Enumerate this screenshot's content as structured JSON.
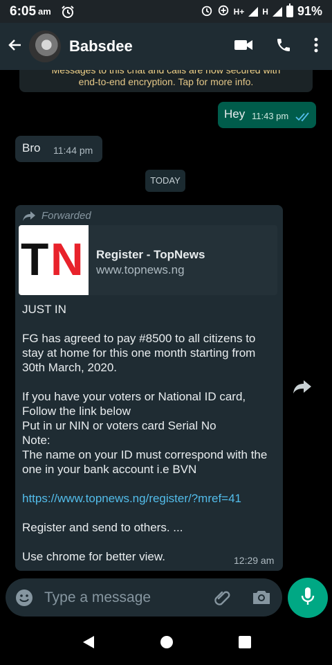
{
  "status": {
    "time": "6:05",
    "ampm": "am",
    "network_hplus": "H+",
    "network_h": "H",
    "battery_percent": "91%"
  },
  "header": {
    "contact_name": "Babsdee"
  },
  "chat": {
    "encryption_notice": {
      "line1": "Messages to this chat and calls are now secured with",
      "line2": "end-to-end encryption. Tap for more info."
    },
    "outgoing": {
      "text": "Hey",
      "time": "11:43 pm",
      "status": "read"
    },
    "incoming": {
      "text": "Bro",
      "time": "11:44 pm"
    },
    "date_divider": "TODAY",
    "forwarded": {
      "label": "Forwarded",
      "preview": {
        "thumb_text_t": "T",
        "thumb_text_n": "N",
        "title": "Register - TopNews",
        "domain": "www.topnews.ng"
      },
      "lines": {
        "l1": "JUST IN",
        "l2": "FG has agreed to pay #8500 to all citizens to stay at home for this one month starting from 30th March, 2020.",
        "l3": "If you have your voters or National ID card, Follow the link below",
        "l4": "Put in ur NIN or voters card Serial No",
        "l5": "Note:",
        "l6": "The name on your ID must correspond with the one in your bank account i.e BVN",
        "link": "https://www.topnews.ng/register/?mref=41",
        "l7": "Register and send to others. ...",
        "l8": "Use chrome for better view."
      },
      "time": "12:29 am"
    }
  },
  "composer": {
    "placeholder": "Type a message"
  },
  "colors": {
    "outgoing_bubble": "#005c4b",
    "incoming_bubble": "#1f2c33",
    "accent": "#00a884",
    "link": "#53bdeb"
  }
}
